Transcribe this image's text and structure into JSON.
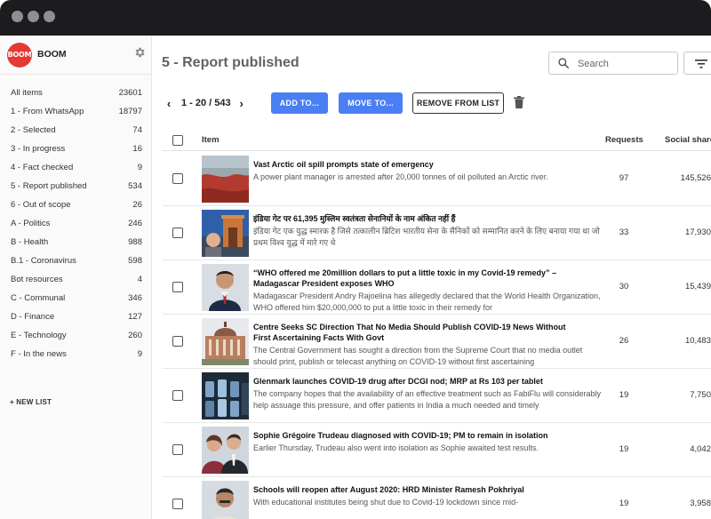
{
  "app": {
    "name": "BOOM",
    "logo_text": "BOOM"
  },
  "sidebar": {
    "items": [
      {
        "label": "All items",
        "count": "23601"
      },
      {
        "label": "1 - From WhatsApp",
        "count": "18797"
      },
      {
        "label": "2 - Selected",
        "count": "74"
      },
      {
        "label": "3 - In progress",
        "count": "16"
      },
      {
        "label": "4 - Fact checked",
        "count": "9"
      },
      {
        "label": "5 - Report published",
        "count": "534"
      },
      {
        "label": "6 - Out of scope",
        "count": "26"
      },
      {
        "label": "A - Politics",
        "count": "246"
      },
      {
        "label": "B - Health",
        "count": "988"
      },
      {
        "label": "B.1 - Coronavirus",
        "count": "598"
      },
      {
        "label": "Bot resources",
        "count": "4"
      },
      {
        "label": "C - Communal",
        "count": "346"
      },
      {
        "label": "D - Finance",
        "count": "127"
      },
      {
        "label": "E - Technology",
        "count": "260"
      },
      {
        "label": "F - In the news",
        "count": "9"
      }
    ],
    "new_list_label": "+ NEW LIST"
  },
  "header": {
    "title": "5 - Report published",
    "search_placeholder": "Search"
  },
  "toolbar": {
    "page_range": "1 - 20 / 543",
    "add_to_label": "ADD TO...",
    "move_to_label": "MOVE TO...",
    "remove_label": "REMOVE FROM LIST"
  },
  "table": {
    "columns": {
      "item": "Item",
      "requests": "Requests",
      "social": "Social shares"
    },
    "rows": [
      {
        "title": "Vast Arctic oil spill prompts state of emergency",
        "desc": "A power plant manager is arrested after 20,000 tonnes of oil polluted an Arctic river.",
        "requests": "97",
        "shares": "145,526"
      },
      {
        "title": "इंडिया गेट पर 61,395 मुस्लिम स्वतंत्रता सेनानियों के नाम अंकित नहीं हैं",
        "desc": "इंडिया गेट एक युद्ध स्मारक है जिसे तत्कालीन ब्रिटिश भारतीय सेना के सैनिकों को सम्मानित करने के लिए बनाया गया था जो प्रथम विश्व युद्ध में मारे गए थे",
        "requests": "33",
        "shares": "17,930"
      },
      {
        "title": "“WHO offered me 20million dollars to put a little toxic in my Covid-19 remedy” – Madagascar President exposes WHO",
        "desc": "Madagascar President Andry Rajoelina has allegedly declared that the World Health Organization, WHO offered him $20,000,000 to put a little toxic in their remedy for",
        "requests": "30",
        "shares": "15,439"
      },
      {
        "title": "Centre Seeks SC Direction That No Media Should Publish COVID-19 News Without First Ascertaining Facts With Govt",
        "desc": "The Central Government has sought a direction from the Supreme Court that no media outlet should print, publish or telecast anything on COVID-19 without first ascertaining",
        "requests": "26",
        "shares": "10,483"
      },
      {
        "title": "Glenmark launches COVID-19 drug after DCGI nod; MRP at Rs 103 per tablet",
        "desc": "The company hopes that the availability of an effective treatment such as FabiFlu will considerably help assuage this pressure, and offer patients in India a much needed and timely",
        "requests": "19",
        "shares": "7,750"
      },
      {
        "title": "Sophie Grégoire Trudeau diagnosed with COVID-19; PM to remain in isolation",
        "desc": "Earlier Thursday, Trudeau also went into isolation as Sophie awaited test results.",
        "requests": "19",
        "shares": "4,042"
      },
      {
        "title": "Schools will reopen after August 2020: HRD Minister Ramesh Pokhriyal",
        "desc": "With educational institutes being shut due to Covid-19 lockdown since mid-",
        "requests": "19",
        "shares": "3,958"
      }
    ]
  },
  "colors": {
    "accent": "#4a7ef5",
    "brand": "#e53935",
    "titlebar": "#1c1c1e"
  }
}
